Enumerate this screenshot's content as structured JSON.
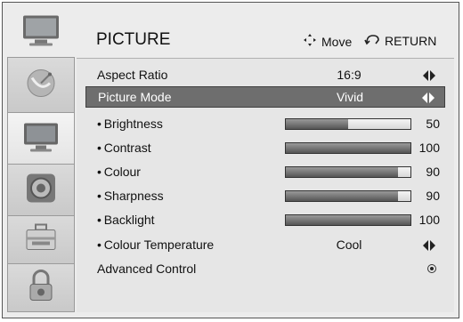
{
  "header": {
    "title": "PICTURE",
    "move_label": "Move",
    "return_label": "RETURN"
  },
  "sidebar": {
    "items": [
      {
        "icon": "tv-icon",
        "selected": false
      },
      {
        "icon": "satellite-dish-icon",
        "selected": false
      },
      {
        "icon": "picture-icon",
        "selected": true
      },
      {
        "icon": "speaker-icon",
        "selected": false
      },
      {
        "icon": "toolbox-icon",
        "selected": false
      },
      {
        "icon": "lock-icon",
        "selected": false
      }
    ]
  },
  "menu": {
    "aspect_ratio": {
      "label": "Aspect Ratio",
      "value": "16:9"
    },
    "picture_mode": {
      "label": "Picture Mode",
      "value": "Vivid"
    },
    "brightness": {
      "label": "Brightness",
      "value": "50",
      "level": 0.5
    },
    "contrast": {
      "label": "Contrast",
      "value": "100",
      "level": 1.0
    },
    "colour": {
      "label": "Colour",
      "value": "90",
      "level": 0.9
    },
    "sharpness": {
      "label": "Sharpness",
      "value": "90",
      "level": 0.9
    },
    "backlight": {
      "label": "Backlight",
      "value": "100",
      "level": 1.0
    },
    "colour_temperature": {
      "label": "Colour Temperature",
      "value": "Cool"
    },
    "advanced_control": {
      "label": "Advanced Control"
    }
  },
  "colors": {
    "selected_row_bg": "#6e6e6e",
    "bar_fill": "#555555",
    "panel_bg": "#e6e6e6"
  }
}
